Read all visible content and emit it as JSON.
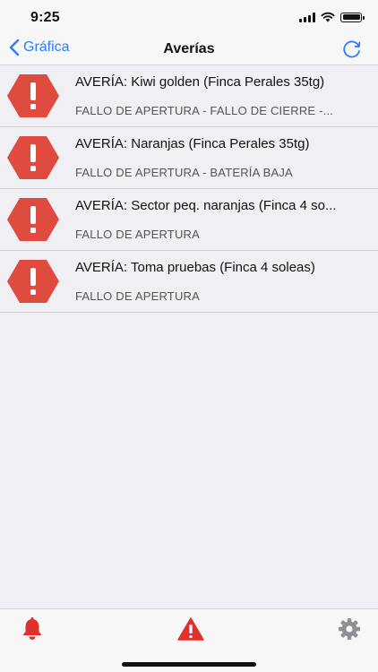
{
  "status_bar": {
    "time": "9:25"
  },
  "nav": {
    "back_label": "Gráfica",
    "title": "Averías",
    "refresh_icon": "refresh-icon"
  },
  "colors": {
    "accent": "#2f7cf6",
    "alert_red": "#e04b40",
    "background": "#efeff4"
  },
  "list": {
    "items": [
      {
        "title": "AVERÍA: Kiwi golden (Finca Perales 35tg)",
        "subtitle": "FALLO DE APERTURA - FALLO DE CIERRE -..."
      },
      {
        "title": "AVERÍA: Naranjas (Finca Perales 35tg)",
        "subtitle": "FALLO DE APERTURA - BATERÍA BAJA"
      },
      {
        "title": "AVERÍA: Sector peq. naranjas (Finca 4 so...",
        "subtitle": "FALLO DE APERTURA"
      },
      {
        "title": "AVERÍA: Toma pruebas (Finca 4 soleas)",
        "subtitle": "FALLO DE APERTURA"
      }
    ]
  },
  "tab_bar": {
    "tabs": [
      {
        "icon": "bell-icon",
        "active": true
      },
      {
        "icon": "warning-icon",
        "active": true
      },
      {
        "icon": "gear-icon",
        "active": false
      }
    ]
  }
}
